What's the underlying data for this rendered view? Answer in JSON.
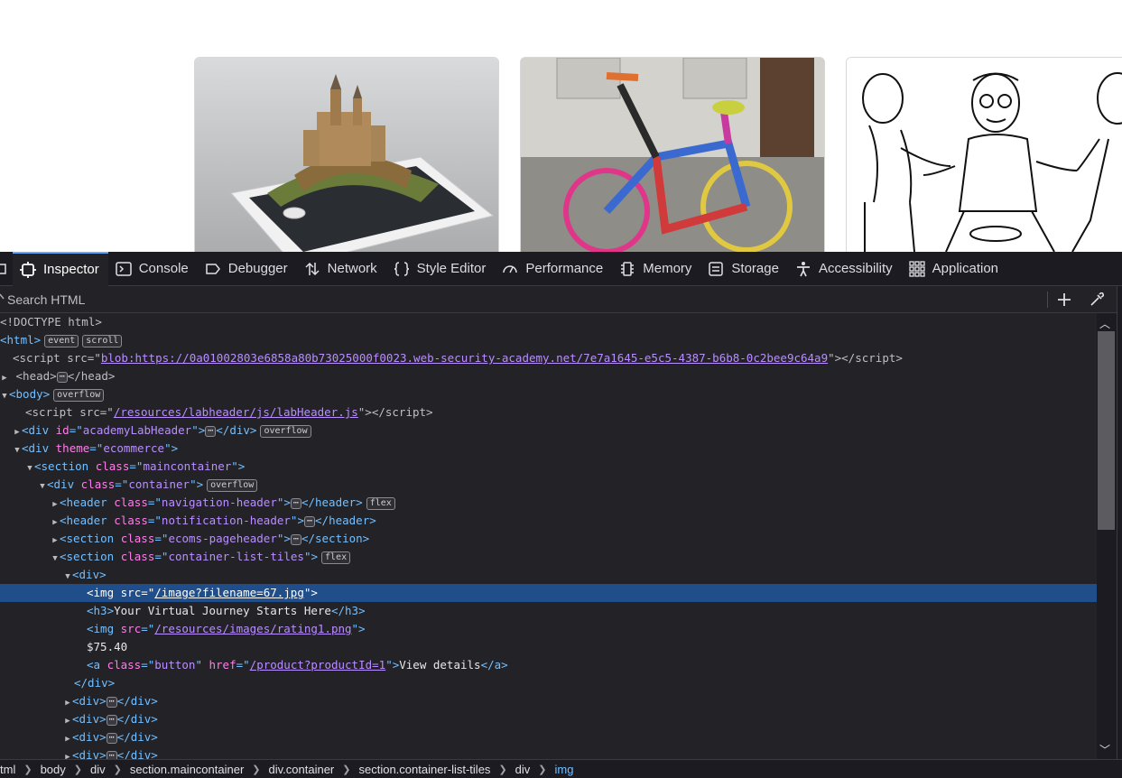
{
  "devtools": {
    "tabs": [
      {
        "label": "Inspector",
        "icon": "inspector-icon",
        "selected": true
      },
      {
        "label": "Console",
        "icon": "console-icon"
      },
      {
        "label": "Debugger",
        "icon": "debugger-icon"
      },
      {
        "label": "Network",
        "icon": "network-icon"
      },
      {
        "label": "Style Editor",
        "icon": "style-editor-icon"
      },
      {
        "label": "Performance",
        "icon": "performance-icon"
      },
      {
        "label": "Memory",
        "icon": "memory-icon"
      },
      {
        "label": "Storage",
        "icon": "storage-icon"
      },
      {
        "label": "Accessibility",
        "icon": "accessibility-icon"
      },
      {
        "label": "Application",
        "icon": "application-icon"
      }
    ],
    "search": {
      "placeholder": "Search HTML"
    },
    "badges": {
      "event": "event",
      "scroll": "scroll",
      "overflow": "overflow",
      "flex": "flex"
    },
    "markup": {
      "doctype": "<!DOCTYPE html>",
      "script_blob_src": "blob:https://0a01002803e6858a80b73025000f0023.web-security-academy.net/7e7a1645-e5c5-4387-b6b8-0c2bee9c64a9",
      "script_labheader_src": "/resources/labheader/js/labHeader.js",
      "academy_id": "academyLabHeader",
      "theme": "ecommerce",
      "section_class": "maincontainer",
      "container_class": "container",
      "nav_header_class": "navigation-header",
      "notif_header_class": "notification-header",
      "pageheader_class": "ecoms-pageheader",
      "tiles_class": "container-list-tiles",
      "img_src": "/image?filename=67.jpg",
      "h3_text": "Your Virtual Journey Starts Here",
      "rating_src": "/resources/images/rating1.png",
      "price": "$75.40",
      "button_class": "button",
      "product_href": "/product?productId=1",
      "link_text": "View details"
    },
    "breadcrumbs": [
      "tml",
      "body",
      "div",
      "section.maincontainer",
      "div.container",
      "section.container-list-tiles",
      "div",
      "img"
    ]
  }
}
